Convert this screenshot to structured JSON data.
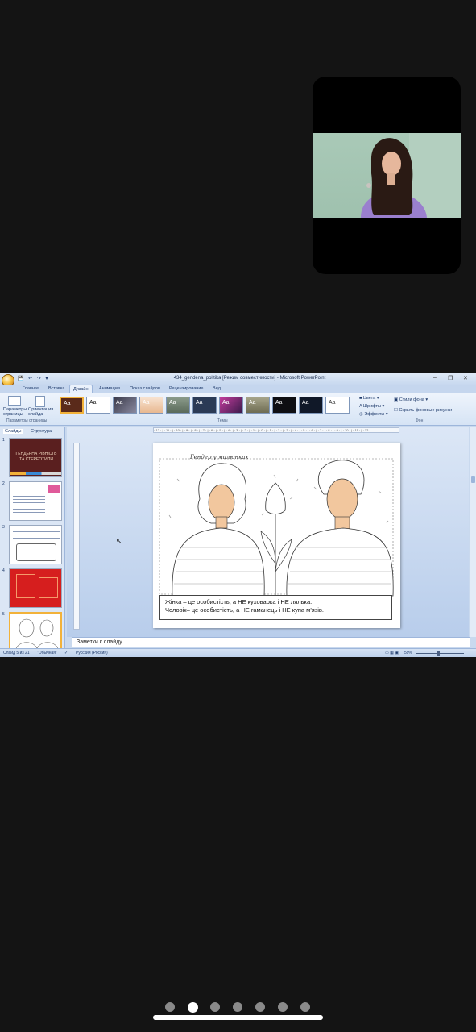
{
  "window": {
    "title": "434_gendena_politika [Режим совместимости] - Microsoft PowerPoint",
    "controls": [
      "‒",
      "❐",
      "✕"
    ]
  },
  "ribbon": {
    "tabs": [
      "Главная",
      "Вставка",
      "Дизайн",
      "Анимация",
      "Показ слайдов",
      "Рецензирование",
      "Вид"
    ],
    "active_tab": "Дизайн",
    "page_setup": {
      "btn1": "Параметры страницы",
      "btn2": "Ориентация слайда",
      "group": "Параметры страницы"
    },
    "themes_group": "Темы",
    "theme_sample": "Aa",
    "theme_options": {
      "colors": "Цвета",
      "fonts": "Шрифты",
      "effects": "Эффекты"
    },
    "background": {
      "styles": "Стили фона",
      "hide": "Скрыть фоновые рисунки",
      "group": "Фон"
    }
  },
  "left_panel": {
    "tabs": [
      "Слайды",
      "Структура"
    ],
    "slides": [
      {
        "num": "1",
        "title": "ГЕНДЕРНА РІВНІСТЬ ТА СТЕРЕОТИПИ"
      },
      {
        "num": "2"
      },
      {
        "num": "3"
      },
      {
        "num": "4"
      },
      {
        "num": "5"
      }
    ]
  },
  "slide": {
    "heading": "Гендер у малюнках",
    "caption_line1": "Жінка – це особистість, а НЕ куховарка і НЕ лялька.",
    "caption_line2": "Чоловік– це особистість, а НЕ гаманець і НЕ купа м'язів."
  },
  "ruler": {
    "marks": "· 12 · | · 11 · | · 10 · | · 9 · | · 8 · | · 7 · | · 6 · | · 5 · | · 4 · | · 3 · | · 2 · | · 1 · | · 0 · | · 1 · | · 2 · | · 3 · | · 4 · | · 5 · | · 6 · | · 7 · | · 8 · | · 9 · | · 10 · | · 11 · | · 12 ·"
  },
  "notes": {
    "placeholder": "Заметки к слайду"
  },
  "status": {
    "slide": "Слайд 5 из 21",
    "theme": "\"Обычная\"",
    "language": "Русский (Россия)",
    "zoom": "59%"
  },
  "pager": {
    "count": 7,
    "active_index": 1
  },
  "colors": {
    "accent": "#f2b23a",
    "slide1_bg": "#5a1f1f",
    "slide4_bg": "#d61e1e"
  }
}
